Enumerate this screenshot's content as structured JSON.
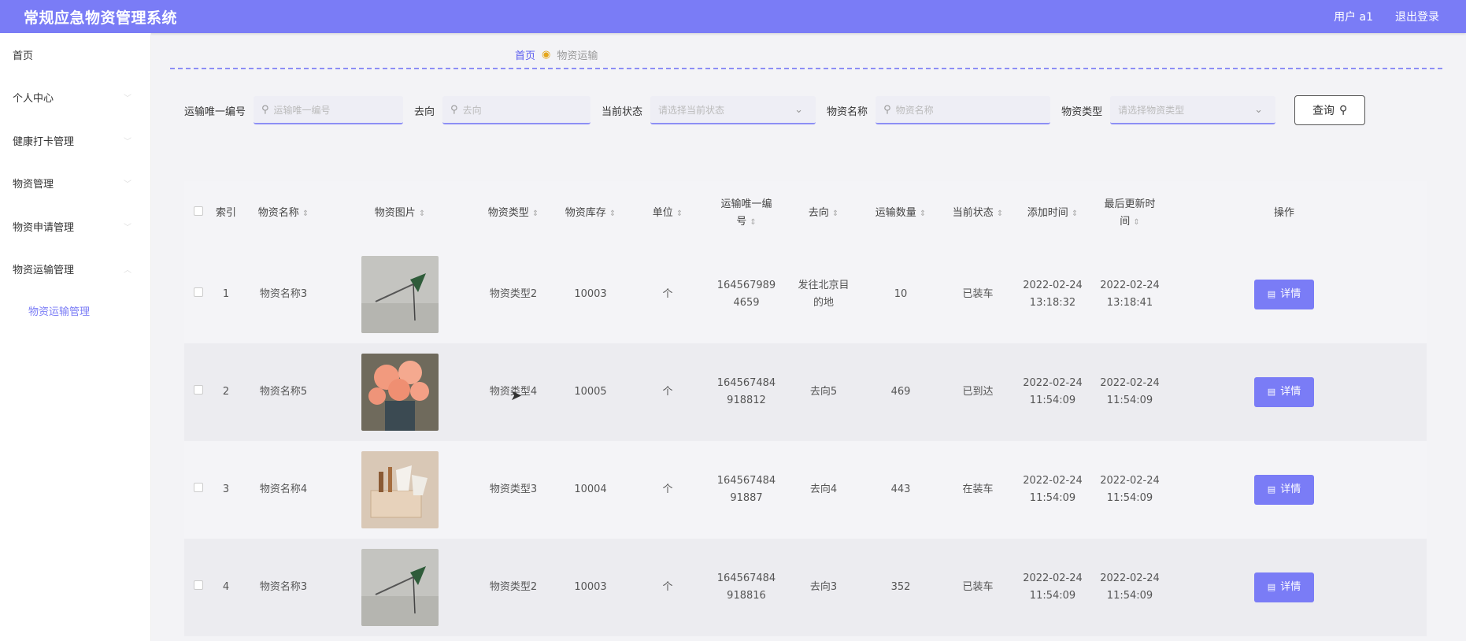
{
  "app": {
    "title": "常规应急物资管理系统"
  },
  "topbar": {
    "user_label": "用户 a1",
    "logout_label": "退出登录"
  },
  "sidebar": {
    "items": [
      {
        "label": "首页",
        "has_chevron": false
      },
      {
        "label": "个人中心",
        "has_chevron": true
      },
      {
        "label": "健康打卡管理",
        "has_chevron": true
      },
      {
        "label": "物资管理",
        "has_chevron": true
      },
      {
        "label": "物资申请管理",
        "has_chevron": true
      },
      {
        "label": "物资运输管理",
        "has_chevron": true
      }
    ],
    "sub_item": "物资运输管理"
  },
  "breadcrumb": {
    "home": "首页",
    "current": "物资运输"
  },
  "search": {
    "transport_id_label": "运输唯一编号",
    "transport_id_placeholder": "运输唯一编号",
    "destination_label": "去向",
    "destination_placeholder": "去向",
    "status_label": "当前状态",
    "status_placeholder": "请选择当前状态",
    "name_label": "物资名称",
    "name_placeholder": "物资名称",
    "type_label": "物资类型",
    "type_placeholder": "请选择物资类型",
    "query_button": "查询"
  },
  "table": {
    "headers": {
      "index": "索引",
      "name": "物资名称",
      "photo": "物资图片",
      "type": "物资类型",
      "stock": "物资库存",
      "unit": "单位",
      "transport_id_1": "运输唯一编",
      "transport_id_2": "号",
      "destination": "去向",
      "quantity": "运输数量",
      "status": "当前状态",
      "added": "添加时间",
      "updated_1": "最后更新时",
      "updated_2": "间",
      "actions": "操作"
    },
    "detail_label": "详情",
    "rows": [
      {
        "index": "1",
        "name": "物资名称3",
        "photo": "pin",
        "type": "物资类型2",
        "stock": "10003",
        "unit": "个",
        "tid_1": "164567989",
        "tid_2": "4659",
        "dest_1": "发往北京目",
        "dest_2": "的地",
        "quantity": "10",
        "status": "已装车",
        "added_date": "2022-02-24",
        "added_time": "13:18:32",
        "updated_date": "2022-02-24",
        "updated_time": "13:18:41"
      },
      {
        "index": "2",
        "name": "物资名称5",
        "photo": "flowers",
        "type": "物资类型4",
        "stock": "10005",
        "unit": "个",
        "tid_1": "164567484",
        "tid_2": "918812",
        "dest_1": "去向5",
        "dest_2": "",
        "quantity": "469",
        "status": "已到达",
        "added_date": "2022-02-24",
        "added_time": "11:54:09",
        "updated_date": "2022-02-24",
        "updated_time": "11:54:09"
      },
      {
        "index": "3",
        "name": "物资名称4",
        "photo": "box",
        "type": "物资类型3",
        "stock": "10004",
        "unit": "个",
        "tid_1": "164567484",
        "tid_2": "91887",
        "dest_1": "去向4",
        "dest_2": "",
        "quantity": "443",
        "status": "在装车",
        "added_date": "2022-02-24",
        "added_time": "11:54:09",
        "updated_date": "2022-02-24",
        "updated_time": "11:54:09"
      },
      {
        "index": "4",
        "name": "物资名称3",
        "photo": "pin",
        "type": "物资类型2",
        "stock": "10003",
        "unit": "个",
        "tid_1": "164567484",
        "tid_2": "918816",
        "dest_1": "去向3",
        "dest_2": "",
        "quantity": "352",
        "status": "已装车",
        "added_date": "2022-02-24",
        "added_time": "11:54:09",
        "updated_date": "2022-02-24",
        "updated_time": "11:54:09"
      }
    ]
  },
  "colors": {
    "accent": "#7a7cf6",
    "breadcrumb_link": "#5a5cf0"
  }
}
